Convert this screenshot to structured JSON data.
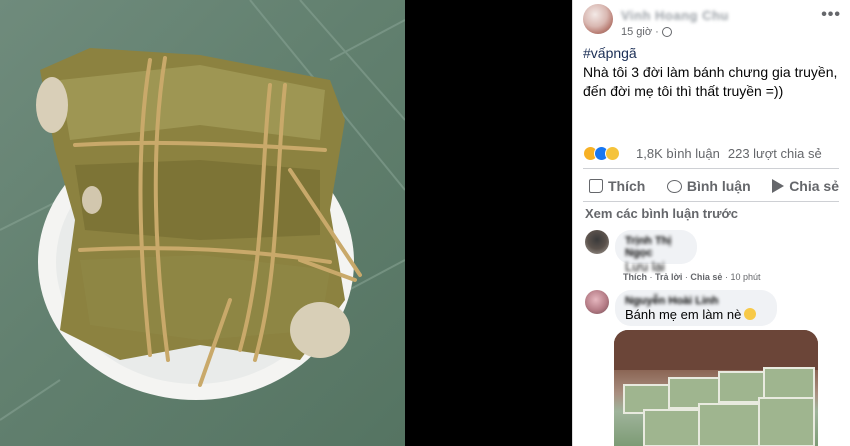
{
  "photo": {
    "alt_subject": "banh-chung"
  },
  "post": {
    "author": "Vinh Hoang Chu",
    "time": "15 giờ ·",
    "more_label": "•••",
    "hashtag": "#vấpngã",
    "body": "Nhà tôi 3 đời làm bánh chưng gia truyền, đến đời mẹ tôi thì thất truyền =))",
    "reaction_count": "",
    "comments_count": "1,8K bình luận",
    "shares_count": "223 lượt chia sẻ",
    "actions": {
      "like": "Thích",
      "comment": "Bình luận",
      "share": "Chia sẻ"
    },
    "view_previous": "Xem các bình luận trước"
  },
  "comments": [
    {
      "name": "Trịnh Thị Ngọc",
      "text": "Lưu lại",
      "meta_like": "Thích",
      "meta_reply": "Trả lời",
      "meta_share": "Chia sẻ",
      "meta_time": "10 phút"
    },
    {
      "name": "Nguyễn Hoài Linh",
      "text": "Bánh mẹ em làm nè"
    }
  ],
  "colors": {
    "facebook_blue": "#1877f2",
    "text_primary": "#050505",
    "text_secondary": "#65676b",
    "bubble_bg": "#f0f2f5"
  }
}
